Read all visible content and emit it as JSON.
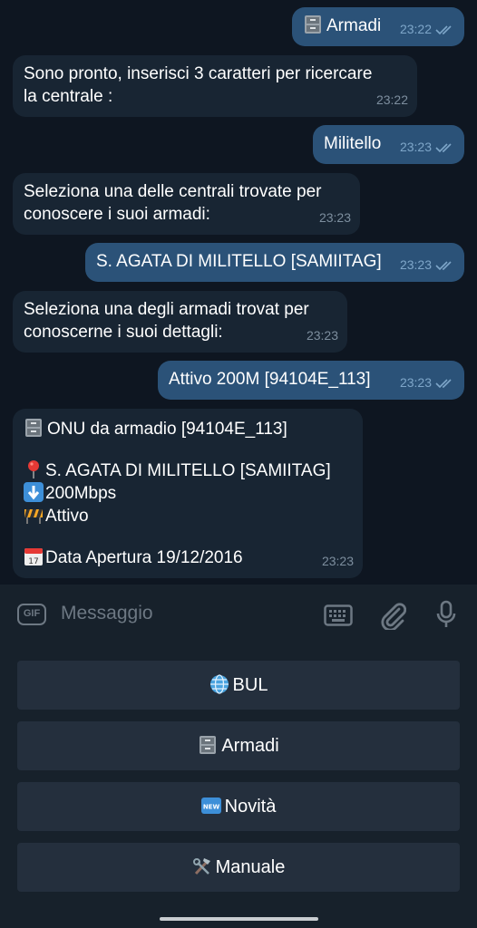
{
  "messages": [
    {
      "dir": "out",
      "text": "Armadi",
      "icon": "file-cabinet-icon",
      "time": "23:22"
    },
    {
      "dir": "in",
      "lines": [
        "Sono pronto, inserisci 3 caratteri per ricercare",
        "la centrale :"
      ],
      "time": "23:22"
    },
    {
      "dir": "out",
      "text": "Militello",
      "time": "23:23"
    },
    {
      "dir": "in",
      "lines": [
        "Seleziona una delle centrali trovate per",
        "conoscere i suoi armadi:"
      ],
      "time": "23:23"
    },
    {
      "dir": "out",
      "text": "S. AGATA DI MILITELLO [SAMIITAG]",
      "time": "23:23"
    },
    {
      "dir": "in",
      "lines": [
        "Seleziona una degli armadi trovat per",
        "conoscerne i suoi dettagli:"
      ],
      "time": "23:23"
    },
    {
      "dir": "out",
      "text": "Attivo 200M [94104E_113]",
      "time": "23:23"
    },
    {
      "dir": "in",
      "time": "23:23",
      "detail": {
        "title": "ONU da armadio [94104E_113]",
        "location": "S. AGATA DI MILITELLO [SAMIITAG]",
        "speed": "200Mbps",
        "status": "Attivo",
        "date_label": "Data Apertura",
        "date_value": "19/12/2016"
      }
    }
  ],
  "composer": {
    "gif_label": "GIF",
    "placeholder": "Messaggio"
  },
  "keyboard": [
    {
      "label": "BUL",
      "icon": "globe-icon"
    },
    {
      "label": "Armadi",
      "icon": "file-cabinet-icon"
    },
    {
      "label": "Novità",
      "icon": "new-badge-icon"
    },
    {
      "label": "Manuale",
      "icon": "tools-icon"
    }
  ],
  "colors": {
    "background": "#0e1621",
    "incoming": "#182533",
    "outgoing": "#2b5278",
    "panel": "#17212b",
    "button": "#242f3d"
  }
}
